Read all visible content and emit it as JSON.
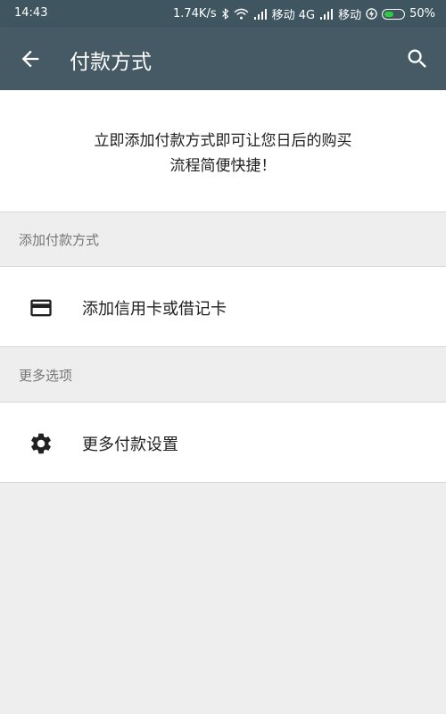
{
  "status_bar": {
    "time": "14:43",
    "speed": "1.74K/s",
    "carrier1": "移动 4G",
    "carrier2": "移动",
    "battery": "50%",
    "battery_level": 0.5
  },
  "app_bar": {
    "title": "付款方式",
    "back_icon": "arrow-back-icon",
    "search_icon": "search-icon"
  },
  "intro": {
    "line1": "立即添加付款方式即可让您日后的购买",
    "line2": "流程简便快捷！"
  },
  "sections": {
    "add_payment": {
      "header": "添加付款方式",
      "item_label": "添加信用卡或借记卡",
      "item_icon": "credit-card-icon"
    },
    "more_options": {
      "header": "更多选项",
      "item_label": "更多付款设置",
      "item_icon": "gear-icon"
    }
  },
  "colors": {
    "app_bar": "#455a64",
    "status_bar": "#3f5661",
    "background": "#eeeeee"
  }
}
